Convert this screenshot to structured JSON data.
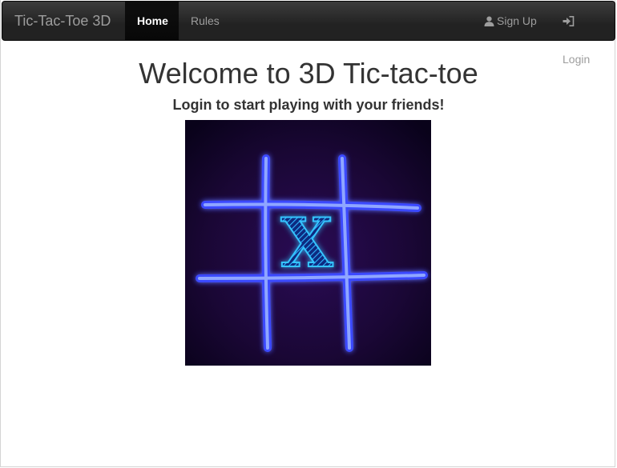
{
  "navbar": {
    "brand": "Tic-Tac-Toe 3D",
    "home_label": "Home",
    "rules_label": "Rules",
    "signup_label": "Sign Up",
    "login_label": "Login"
  },
  "main": {
    "title": "Welcome to 3D Tic-tac-toe",
    "subtitle": "Login to start playing with your friends!",
    "hero_mark": "X"
  },
  "icons": {
    "signup": "user-icon",
    "login": "login-icon"
  },
  "colors": {
    "navbar_bg": "#222222",
    "nav_text": "#9d9d9d",
    "nav_active_text": "#ffffff",
    "heading_text": "#333333",
    "glow_blue": "#4a63ff",
    "board_bg": "#1a0735"
  }
}
